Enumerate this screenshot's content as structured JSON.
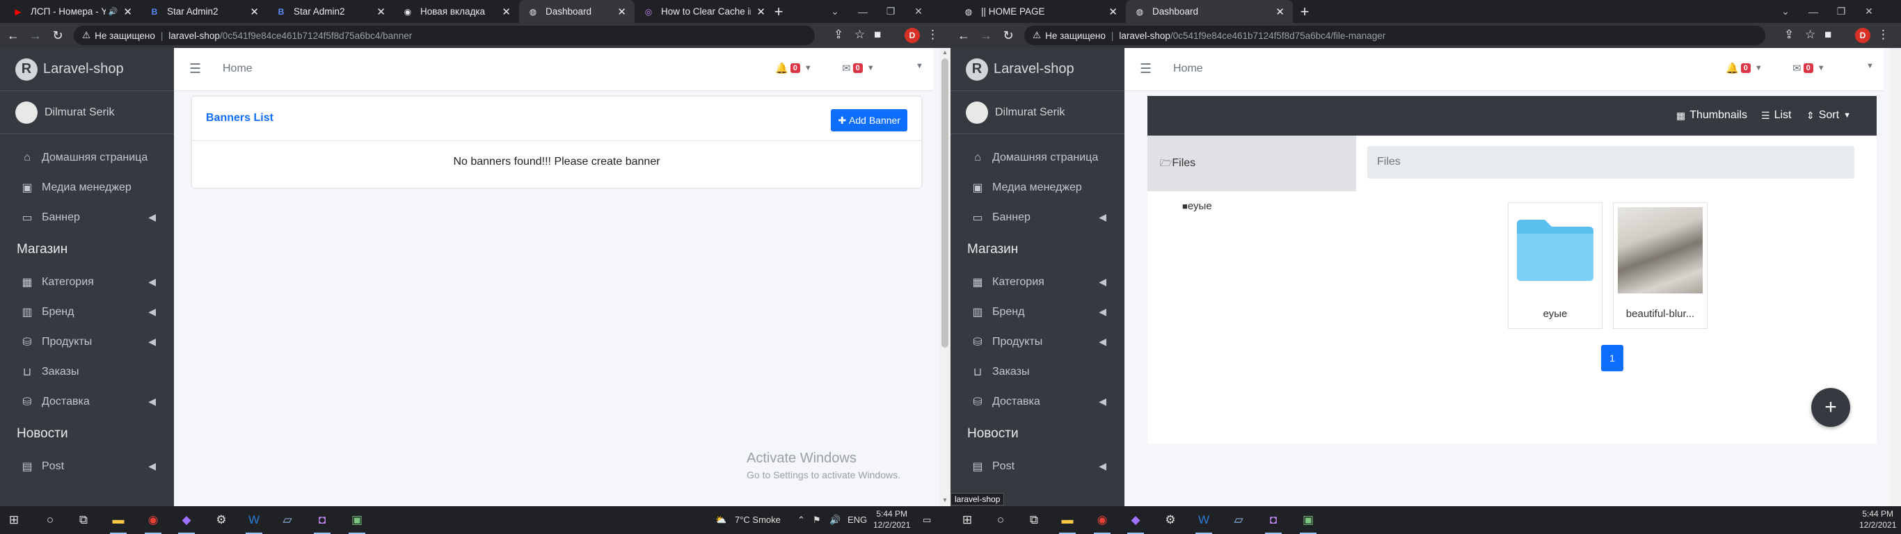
{
  "left_window": {
    "tabs": [
      {
        "title": "ЛСП - Номера - Y",
        "icon": "youtube-icon",
        "active": false
      },
      {
        "title": "Star Admin2",
        "icon": "bootstrap-icon",
        "active": false
      },
      {
        "title": "Star Admin2",
        "icon": "bootstrap-icon",
        "active": false
      },
      {
        "title": "Новая вкладка",
        "icon": "chrome-icon",
        "active": false
      },
      {
        "title": "Dashboard",
        "icon": "globe-icon",
        "active": true
      },
      {
        "title": "How to Clear Cache in",
        "icon": "article-icon",
        "active": false
      }
    ],
    "address": {
      "security": "Не защищено",
      "domain": "laravel-shop",
      "path": "/0c541f9e84ce461b7124f5f8d75a6bc4/banner"
    },
    "profile_letter": "D",
    "brand": "Laravel-shop",
    "brand_logo": "R",
    "user": "Dilmurat Serik",
    "menu": [
      {
        "label": "Домашняя страница",
        "icon": "home-icon",
        "chevron": false
      },
      {
        "label": "Медиа менеджер",
        "icon": "images-icon",
        "chevron": false
      },
      {
        "label": "Баннер",
        "icon": "desktop-icon",
        "chevron": true
      }
    ],
    "section_shop": "Магазин",
    "shop_menu": [
      {
        "label": "Категория",
        "icon": "grid-icon",
        "chevron": true
      },
      {
        "label": "Бренд",
        "icon": "building-icon",
        "chevron": true
      },
      {
        "label": "Продукты",
        "icon": "hdd-icon",
        "chevron": true
      },
      {
        "label": "Заказы",
        "icon": "basket-icon",
        "chevron": false
      },
      {
        "label": "Доставка",
        "icon": "hdd-icon",
        "chevron": true
      }
    ],
    "section_news": "Новости",
    "news_menu": [
      {
        "label": "Post",
        "icon": "post-icon",
        "chevron": true
      }
    ],
    "topnav": {
      "home": "Home",
      "bell_count": "0",
      "mail_count": "0"
    },
    "card": {
      "title": "Banners List",
      "add_button": "Add Banner",
      "empty": "No banners found!!! Please create banner"
    },
    "watermark_title": "Activate Windows",
    "watermark_sub": "Go to Settings to activate Windows."
  },
  "right_window": {
    "tabs": [
      {
        "title": "|| HOME PAGE",
        "icon": "globe-icon",
        "active": false
      },
      {
        "title": "Dashboard",
        "icon": "globe-icon",
        "active": true
      }
    ],
    "address": {
      "security": "Не защищено",
      "domain": "laravel-shop",
      "path": "/0c541f9e84ce461b7124f5f8d75a6bc4/file-manager"
    },
    "profile_letter": "D",
    "brand": "Laravel-shop",
    "brand_logo": "R",
    "user": "Dilmurat Serik",
    "menu": [
      {
        "label": "Домашняя страница",
        "icon": "home-icon",
        "chevron": false
      },
      {
        "label": "Медиа менеджер",
        "icon": "images-icon",
        "chevron": false
      },
      {
        "label": "Баннер",
        "icon": "desktop-icon",
        "chevron": true
      }
    ],
    "section_shop": "Магазин",
    "shop_menu": [
      {
        "label": "Категория",
        "icon": "grid-icon",
        "chevron": true
      },
      {
        "label": "Бренд",
        "icon": "building-icon",
        "chevron": true
      },
      {
        "label": "Продукты",
        "icon": "hdd-icon",
        "chevron": true
      },
      {
        "label": "Заказы",
        "icon": "basket-icon",
        "chevron": false
      },
      {
        "label": "Доставка",
        "icon": "hdd-icon",
        "chevron": true
      }
    ],
    "section_news": "Новости",
    "news_menu": [
      {
        "label": "Post",
        "icon": "post-icon",
        "chevron": true
      }
    ],
    "topnav": {
      "home": "Home",
      "bell_count": "0",
      "mail_count": "0"
    },
    "file_manager": {
      "view_thumbnails": "Thumbnails",
      "view_list": "List",
      "sort": "Sort",
      "sidebar_label": "Files",
      "breadcrumb": "Files",
      "tree_item": "еуые",
      "items": [
        {
          "name": "еуые",
          "type": "folder"
        },
        {
          "name": "beautiful-blur...",
          "type": "image"
        }
      ],
      "page": "1",
      "fab": "+"
    },
    "tooltip": "laravel-shop"
  },
  "taskbar": {
    "left": {
      "weather": "7°C  Smoke",
      "lang": "ENG",
      "time": "5:44 PM",
      "date": "12/2/2021"
    },
    "right": {
      "time": "5:44 PM",
      "date": "12/2/2021"
    }
  }
}
